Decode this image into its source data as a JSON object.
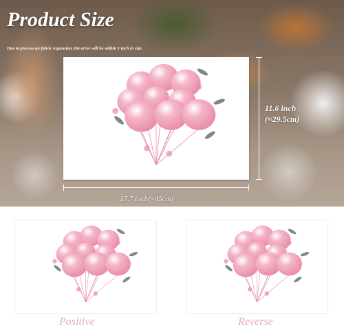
{
  "header": {
    "title": "Product Size",
    "note": "Due to process an fabric expansion, the error will be within 1 inch in size."
  },
  "dimensions": {
    "width_label": "17.7 inch(≈45cm)",
    "height_label_line1": "11.6 inch",
    "height_label_line2": "(≈29.5cm)"
  },
  "views": {
    "positive_label": "Positive",
    "reverse_label": "Reverse"
  },
  "artwork": {
    "subject": "pink balloon bouquet",
    "balloon_color": "#f4b6c8",
    "balloon_shade": "#e88aa6",
    "leaf_color": "#7d8a84",
    "caption_color": "#e8adb3"
  }
}
